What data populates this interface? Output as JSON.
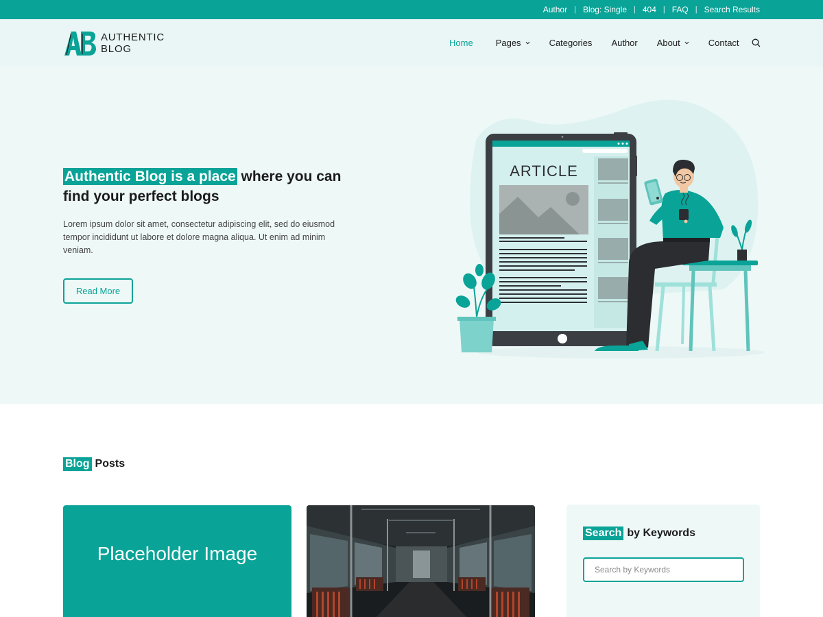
{
  "topbar": {
    "links": [
      {
        "label": "Author"
      },
      {
        "label": "Blog: Single"
      },
      {
        "label": "404"
      },
      {
        "label": "FAQ"
      },
      {
        "label": "Search Results"
      }
    ],
    "separator": "|"
  },
  "header": {
    "logo": {
      "mark": "AB",
      "line1": "AUTHENTIC",
      "line2": "BLOG"
    },
    "nav": [
      {
        "label": "Home",
        "active": true,
        "dropdown": false
      },
      {
        "label": "Pages",
        "active": false,
        "dropdown": true
      },
      {
        "label": "Categories",
        "active": false,
        "dropdown": false
      },
      {
        "label": "Author",
        "active": false,
        "dropdown": false
      },
      {
        "label": "About",
        "active": false,
        "dropdown": true
      },
      {
        "label": "Contact",
        "active": false,
        "dropdown": false
      }
    ],
    "search_icon": "search-icon"
  },
  "hero": {
    "title_highlight": "Authentic Blog is a place",
    "title_rest": " where you can find your perfect blogs",
    "description": "Lorem ipsum dolor sit amet, consectetur adipiscing elit, sed do eiusmod tempor incididunt ut labore et dolore magna aliqua. Ut enim ad minim veniam.",
    "button_label": "Read More",
    "illustration": {
      "screen_heading": "ARTICLE"
    }
  },
  "blog": {
    "title_highlight": "Blog",
    "title_rest": "Posts",
    "cards": [
      {
        "image_text": "Placeholder Image"
      },
      {
        "image_text": ""
      }
    ]
  },
  "sidebar": {
    "title_highlight": "Search",
    "title_rest": "by Keywords",
    "search_placeholder": "Search by Keywords"
  },
  "colors": {
    "accent": "#0aa397",
    "hero_bg": "#eef8f7",
    "header_bg": "#e9f6f5"
  }
}
